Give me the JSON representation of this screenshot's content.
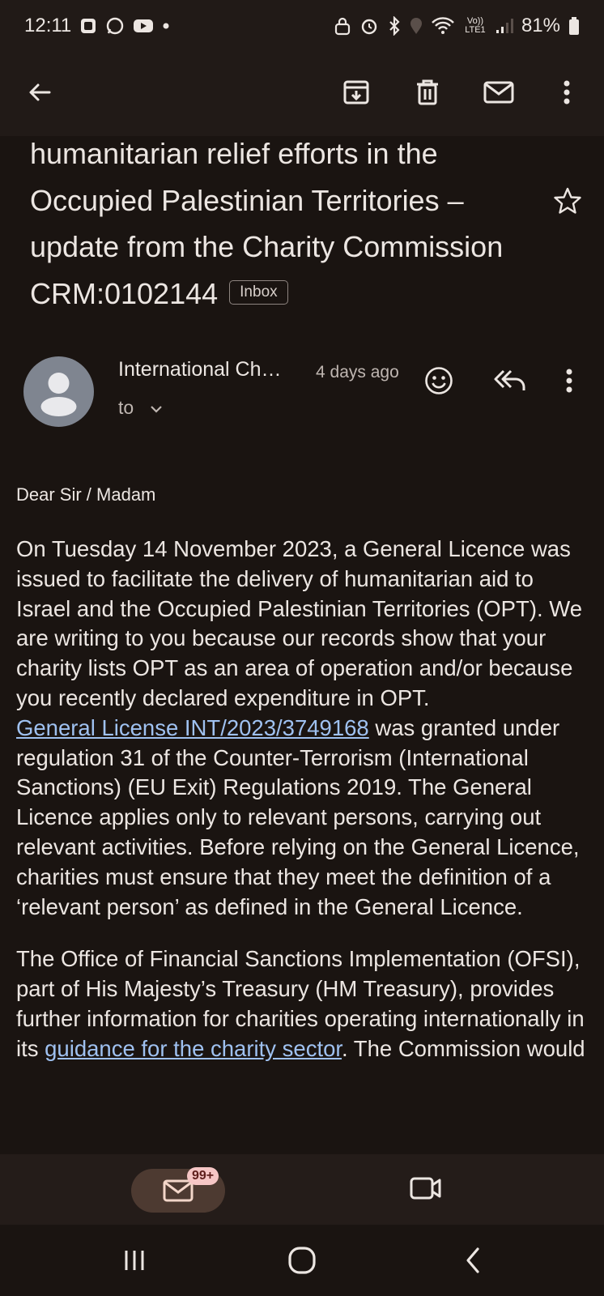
{
  "status_bar": {
    "time": "12:11",
    "network": "Vo)) LTE1",
    "battery": "81%"
  },
  "toolbar": {
    "icons": [
      "back-arrow-icon",
      "archive-icon",
      "delete-icon",
      "mark-unread-icon",
      "more-vert-icon"
    ]
  },
  "subject": {
    "text": "humanitarian relief efforts in the Occupied Palestinian Territories – update from the Charity Commission CRM:0102144",
    "label": "Inbox"
  },
  "message_header": {
    "sender": "International Ch…",
    "date": "4 days ago",
    "to_label": "to"
  },
  "body": {
    "greeting": "Dear Sir / Madam",
    "p1_a": "On Tuesday 14 November 2023, a General Licence was issued to facilitate the delivery of humanitarian aid to Israel and the Occupied Palestinian Territories (OPT). We are writing to you because our records show that your charity lists OPT as an area of operation and/or because you recently declared expenditure in OPT.",
    "p1_link": "General License INT/2023/3749168",
    "p1_b": " was granted under regulation 31 of the Counter-Terrorism (International Sanctions) (EU Exit) Regulations 2019. The General Licence applies only to relevant persons, carrying out relevant activities. Before relying on the General Licence, charities must ensure that they meet the definition of a ‘relevant person’ as defined in the General Licence.",
    "p2_a": "The Office of Financial Sanctions Implementation (OFSI), part of His Majesty’s Treasury (HM Treasury), provides further information for charities operating internationally in its ",
    "p2_link": "guidance for the charity sector",
    "p2_b": ". The Commission would"
  },
  "bottom_bar": {
    "mail_badge": "99+"
  },
  "colors": {
    "background": "#1a1411",
    "bars": "#211a17",
    "link": "#9fc1f0",
    "pill": "#4d3a31",
    "badge": "#f6c6c5"
  }
}
